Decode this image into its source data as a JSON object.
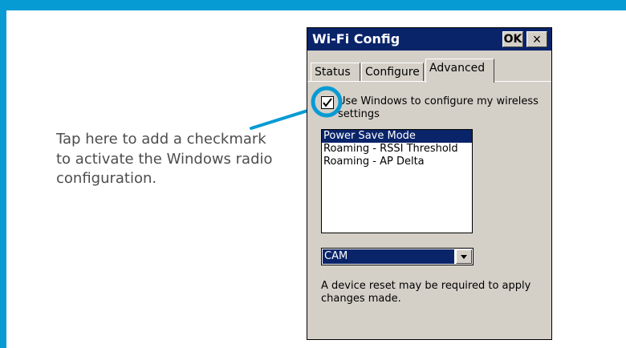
{
  "callout": {
    "text_line1": "Tap here to add a checkmark",
    "text_line2": "to activate the Windows radio",
    "text_line3": "configuration."
  },
  "window": {
    "title": "Wi-Fi Config",
    "ok_label": "OK",
    "close_label": "×"
  },
  "tabs": [
    {
      "label": "Status"
    },
    {
      "label": "Configure"
    },
    {
      "label": "Advanced"
    }
  ],
  "checkbox": {
    "checked": true,
    "label": "Use Windows to configure my wireless settings"
  },
  "list": {
    "items": [
      {
        "label": "Power Save Mode",
        "selected": true
      },
      {
        "label": "Roaming - RSSI Threshold",
        "selected": false
      },
      {
        "label": "Roaming - AP Delta",
        "selected": false
      }
    ]
  },
  "dropdown": {
    "value": "CAM"
  },
  "note": "A device reset may be required to apply changes made.",
  "colors": {
    "frame": "#079bd4",
    "titlebar": "#0a246a",
    "dialog": "#d4d0c8"
  }
}
